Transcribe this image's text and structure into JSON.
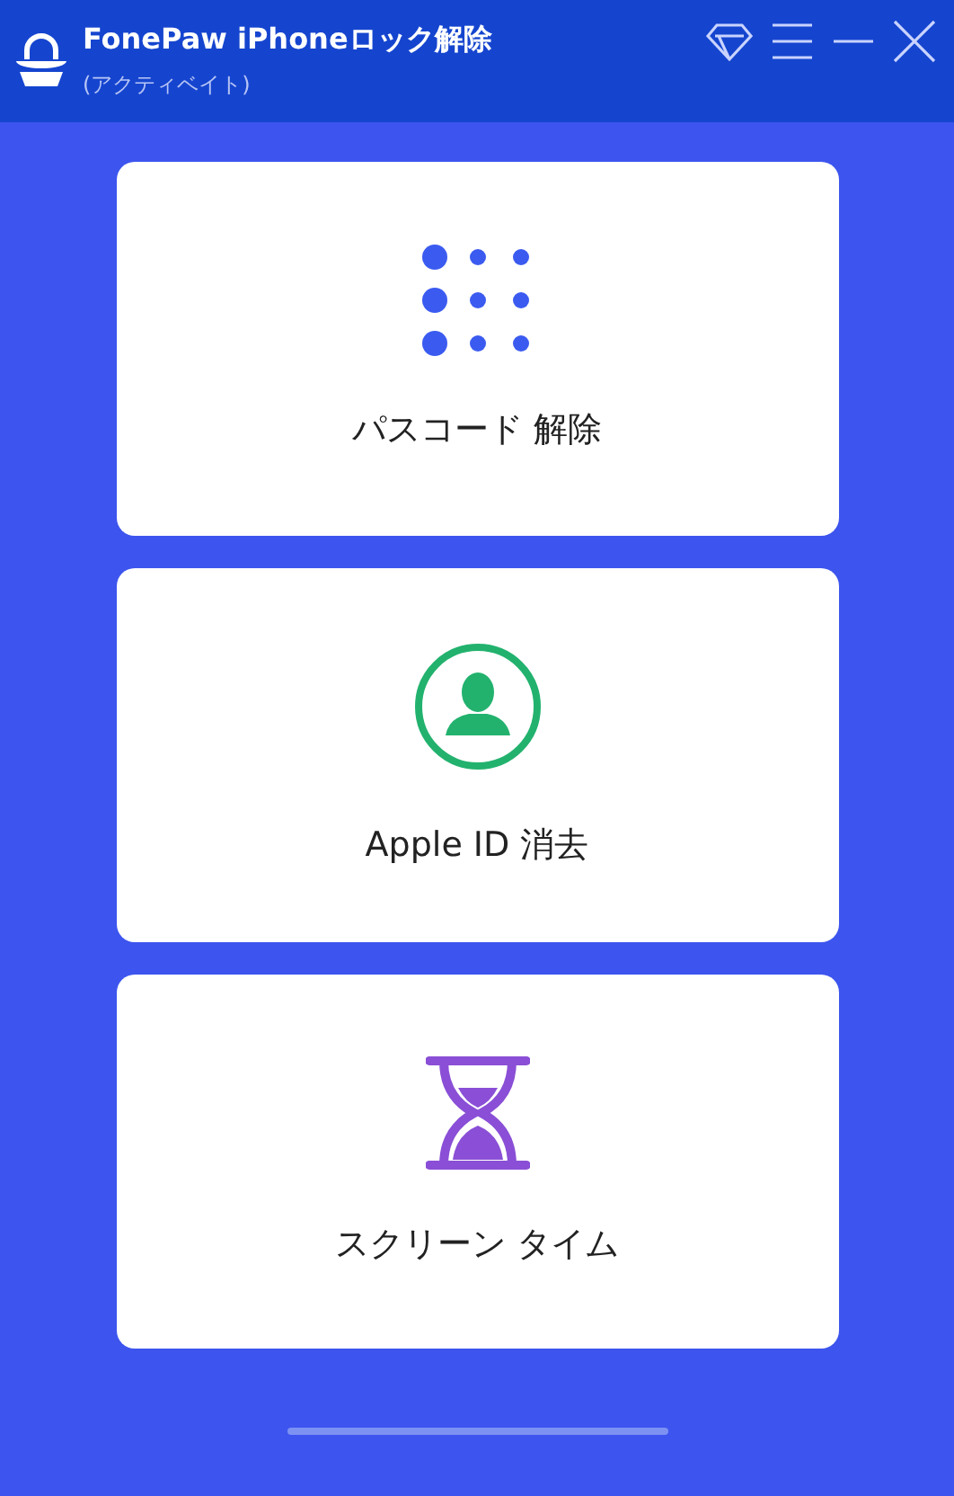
{
  "window": {
    "title": "FonePaw iPhoneロック解除",
    "subtitle": "(アクティベイト)"
  },
  "cards": [
    {
      "kind": "passcode",
      "label": "パスコード 解除"
    },
    {
      "kind": "appleid",
      "label": "Apple ID 消去"
    },
    {
      "kind": "screentime",
      "label": "スクリーン タイム"
    }
  ]
}
